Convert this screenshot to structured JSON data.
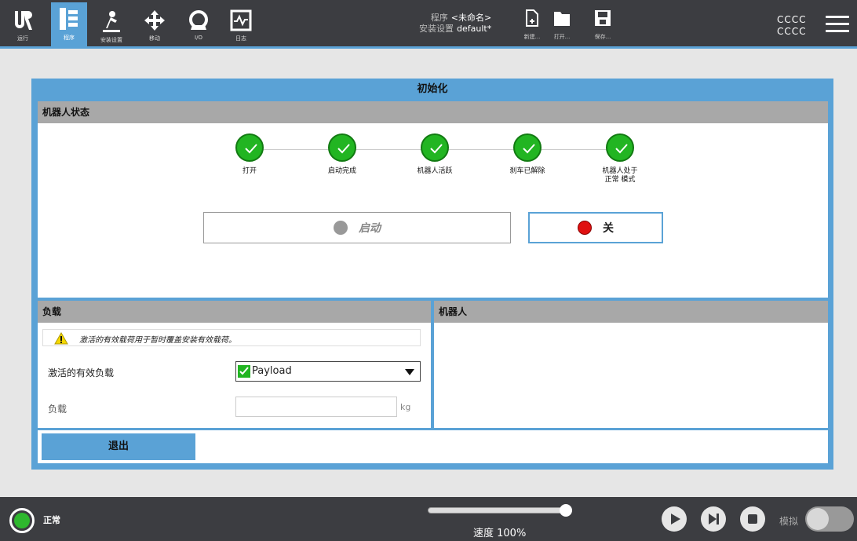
{
  "topbar": {
    "nav": [
      {
        "label": "运行",
        "icon": "ur-logo-icon"
      },
      {
        "label": "程序",
        "icon": "program-icon"
      },
      {
        "label": "安装设置",
        "icon": "installation-icon"
      },
      {
        "label": "移动",
        "icon": "move-icon"
      },
      {
        "label": "I/O",
        "icon": "io-icon"
      },
      {
        "label": "日志",
        "icon": "log-icon"
      }
    ],
    "program_label": "程序",
    "program_value": "<未命名>",
    "installation_label": "安装设置",
    "installation_value": "default*",
    "file": {
      "new": "新建...",
      "open": "打开...",
      "save": "保存..."
    },
    "user_line1": "CCCC",
    "user_line2": "CCCC"
  },
  "dialog": {
    "title": "初始化",
    "robot_state": {
      "header": "机器人状态",
      "steps": [
        "打开",
        "启动完成",
        "机器人活跃",
        "刹车已解除",
        "机器人处于\n正常 模式"
      ],
      "start_label": "启动",
      "off_label": "关"
    },
    "payload": {
      "header": "负载",
      "warning": "激活的有效载荷用于暂时覆盖安装有效载荷。",
      "active_label": "激活的有效负载",
      "active_value": "Payload",
      "payload_label": "负载",
      "payload_value": "",
      "unit": "kg"
    },
    "robot_panel": {
      "header": "机器人"
    },
    "exit_label": "退出"
  },
  "bottombar": {
    "status": "正常",
    "speed": "速度 100%",
    "speed_fraction": 1.0,
    "sim_label": "模拟"
  },
  "colors": {
    "accent": "#5aa2d6",
    "ok": "#22b522",
    "stop": "#e01010",
    "dark": "#3c3d41"
  }
}
